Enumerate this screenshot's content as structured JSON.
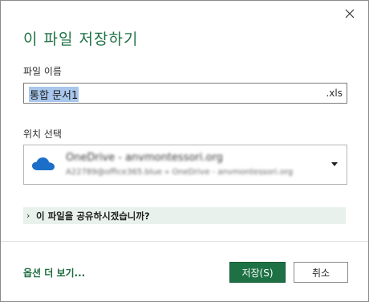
{
  "dialog": {
    "title": "이 파일 저장하기",
    "close_icon": "close-icon"
  },
  "file_name": {
    "label": "파일 이름",
    "value": "통합 문서1",
    "extension": ".xls"
  },
  "location": {
    "label": "위치 선택",
    "selected_name": "OneDrive - anvmontessori.org",
    "selected_path": "A22789@office365.blue » OneDrive - anvmontessori.org",
    "icon": "onedrive-cloud-icon",
    "dropdown_icon": "chevron-down-icon"
  },
  "share": {
    "chevron": "›",
    "label": "이 파일을 공유하시겠습니까?"
  },
  "footer": {
    "more_options": "옵션 더 보기...",
    "save_label": "저장(S)",
    "cancel_label": "취소"
  },
  "colors": {
    "accent": "#1e7145",
    "share_bar_bg": "#e9f1ec",
    "selection": "#a9c7ec",
    "cloud": "#1c6fc8"
  }
}
